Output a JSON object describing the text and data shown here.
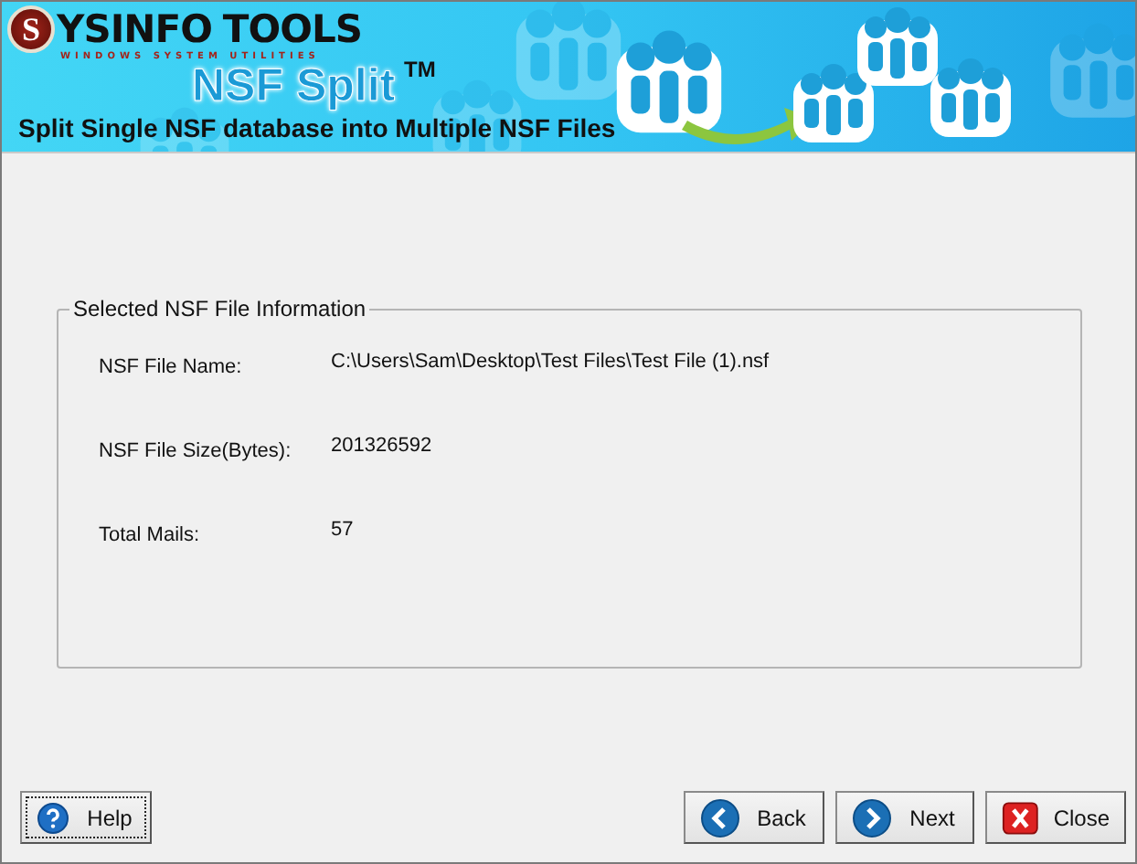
{
  "banner": {
    "logo_initial": "S",
    "logo_name": "YSINFO",
    "logo_name_2": "TOOLS",
    "logo_tagline": "WINDOWS SYSTEM UTILITIES",
    "product": "NSF Split",
    "trademark": "TM",
    "subtitle": "Split Single NSF database into Multiple NSF Files"
  },
  "file_info": {
    "title": "Selected NSF File Information",
    "rows": [
      {
        "label": "NSF File Name:",
        "value": "C:\\Users\\Sam\\Desktop\\Test Files\\Test File (1).nsf"
      },
      {
        "label": "NSF File Size(Bytes):",
        "value": "201326592"
      },
      {
        "label": "Total Mails:",
        "value": "57"
      }
    ]
  },
  "buttons": [
    {
      "kind": "help",
      "label": "Help",
      "focused": true
    },
    {
      "kind": "back",
      "label": "Back",
      "focused": false
    },
    {
      "kind": "next",
      "label": "Next",
      "focused": false
    },
    {
      "kind": "close",
      "label": "Close",
      "focused": false
    }
  ]
}
